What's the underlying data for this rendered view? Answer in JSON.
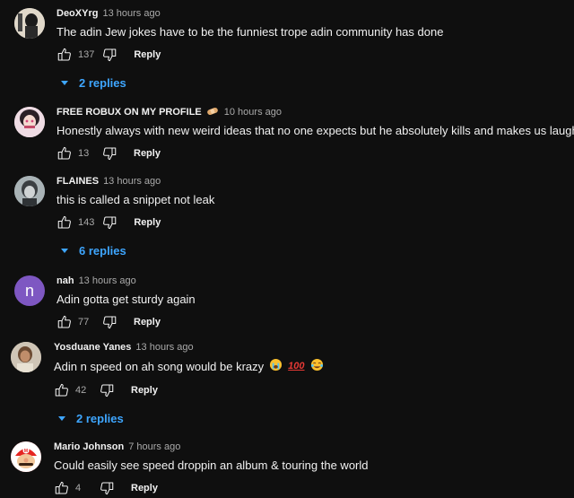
{
  "comments": [
    {
      "author": "DeoXYrg",
      "time": "13 hours ago",
      "text": "The adin Jew jokes have to be the funniest trope adin community has done",
      "likes": "137",
      "reply_label": "Reply",
      "replies": "2 replies"
    },
    {
      "author": "FREE ROBUX ON MY PROFILE",
      "author_emoji": "bandage",
      "time": "10 hours ago",
      "text": "Honestly always with new weird ideas that no one expects but he absolutely kills and makes us laugh",
      "likes": "13",
      "reply_label": "Reply"
    },
    {
      "author": "FLAINES",
      "time": "13 hours ago",
      "text": "this is called a snippet not leak",
      "likes": "143",
      "reply_label": "Reply",
      "replies": "6 replies"
    },
    {
      "author": "nah",
      "avatar_letter": "n",
      "avatar_color": "#7e57c2",
      "time": "13 hours ago",
      "text": "Adin gotta get sturdy again",
      "likes": "77",
      "reply_label": "Reply"
    },
    {
      "author": "Yosduane Yanes",
      "time": "13 hours ago",
      "text": "Adin n speed on ah song would be krazy",
      "text_emojis": [
        "loudly-crying-face",
        "hundred-points",
        "face-with-tears-of-joy"
      ],
      "likes": "42",
      "reply_label": "Reply",
      "replies": "2 replies"
    },
    {
      "author": "Mario Johnson",
      "time": "7 hours ago",
      "text": "Could easily see speed droppin an album & touring the world",
      "likes": "4",
      "reply_label": "Reply"
    }
  ],
  "icons": {
    "like": "thumbs-up-icon",
    "dislike": "thumbs-down-icon",
    "expand": "caret-down-icon"
  },
  "colors": {
    "background": "#0f0f0f",
    "link": "#3ea6ff",
    "secondary_text": "#aaaaaa"
  }
}
